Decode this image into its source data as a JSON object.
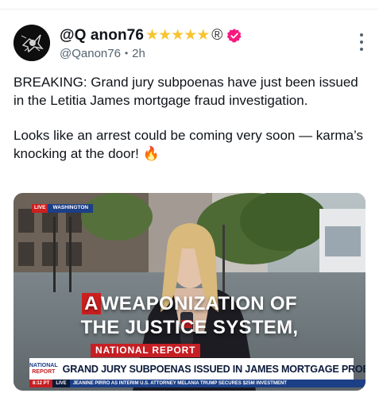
{
  "post": {
    "display_name": "@Q anon76",
    "stars": [
      "★",
      "★",
      "★",
      "★",
      "★"
    ],
    "registered_mark": "®",
    "handle": "@Qanon76",
    "separator": "•",
    "time": "2h",
    "text_line_1": "BREAKING: Grand jury subpoenas have just been issued in the Letitia James mortgage fraud investigation.",
    "text_line_2": "Looks like an arrest could be coming very soon — karma’s knocking at the door! 🔥"
  },
  "media": {
    "live_label": "LIVE",
    "location_label": "WASHINGTON",
    "overlay_highlight": "A",
    "overlay_line_1_rest": "WEAPONIZATION OF",
    "overlay_line_2": "THE JUSTICE SYSTEM,",
    "section_label": "NATIONAL REPORT",
    "logo_line_1": "NATIONAL",
    "logo_line_2": "REPORT",
    "headline": "GRAND JURY SUBPOENAS ISSUED IN JAMES MORTGAGE PROBE",
    "ticker_time": "8:12 PT",
    "ticker_live": "LIVE",
    "ticker_text": "JEANINE PIRRO AS INTERIM U.S. ATTORNEY       MELANIA TRUMP SECURES $25M INVESTMENT"
  },
  "colors": {
    "star": "#f7c530",
    "verified": "#f91880",
    "network_red": "#c51f24",
    "network_blue": "#1c3f86"
  },
  "icons": {
    "avatar": "avatar-image",
    "verified": "verified-badge-icon",
    "more": "more-vertical-icon"
  }
}
